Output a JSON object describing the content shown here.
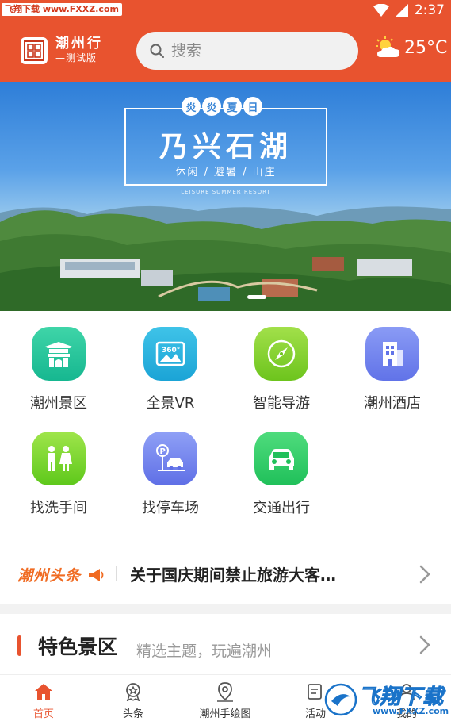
{
  "status_bar": {
    "watermark": "飞翔下载 www.FXXZ.com",
    "time": "2:37"
  },
  "header": {
    "app_title": "潮州行",
    "app_subtitle": "—测试版",
    "search_placeholder": "搜索",
    "temperature": "25°C",
    "weather_icon": "partly-cloudy-icon",
    "background_color": "#e8532f"
  },
  "banner": {
    "tag_chars": [
      "炎",
      "炎",
      "夏",
      "日"
    ],
    "title": "乃兴石湖",
    "subtitle": "休闲 / 避暑 / 山庄",
    "english": "LEISURE SUMMER RESORT",
    "active_slide": 1
  },
  "grid": {
    "items": [
      {
        "label": "潮州景区",
        "icon": "gate-icon",
        "color_top": "#3fd5a8",
        "color_bottom": "#16b790"
      },
      {
        "label": "全景VR",
        "icon": "panorama-360-icon",
        "color_top": "#3fc3e8",
        "color_bottom": "#1ba4d6"
      },
      {
        "label": "智能导游",
        "icon": "compass-icon",
        "color_top": "#a2e04a",
        "color_bottom": "#6dc41d"
      },
      {
        "label": "潮州酒店",
        "icon": "hotel-building-icon",
        "color_top": "#8a9bf5",
        "color_bottom": "#6173e8"
      },
      {
        "label": "找洗手间",
        "icon": "restroom-icon",
        "color_top": "#9fe54b",
        "color_bottom": "#5ec81b"
      },
      {
        "label": "找停车场",
        "icon": "parking-icon",
        "color_top": "#8fa0f6",
        "color_bottom": "#5f6fe6"
      },
      {
        "label": "交通出行",
        "icon": "car-icon",
        "color_top": "#4fdc7d",
        "color_bottom": "#20c05a"
      }
    ]
  },
  "news": {
    "brand": "潮州头条",
    "headline": "关于国庆期间禁止旅游大客…"
  },
  "section": {
    "title": "特色景区",
    "subtitle": "精选主题，玩遍潮州"
  },
  "tabbar": {
    "tabs": [
      {
        "label": "首页",
        "icon": "home-icon",
        "active": true
      },
      {
        "label": "头条",
        "icon": "medal-icon",
        "active": false
      },
      {
        "label": "潮州手绘图",
        "icon": "map-pin-icon",
        "active": false
      },
      {
        "label": "活动",
        "icon": "activity-icon",
        "active": false
      },
      {
        "label": "我的",
        "icon": "user-icon",
        "active": false
      }
    ]
  },
  "footer_watermark": {
    "text": "飞翔下载",
    "url": "www.FXXZ.com"
  }
}
